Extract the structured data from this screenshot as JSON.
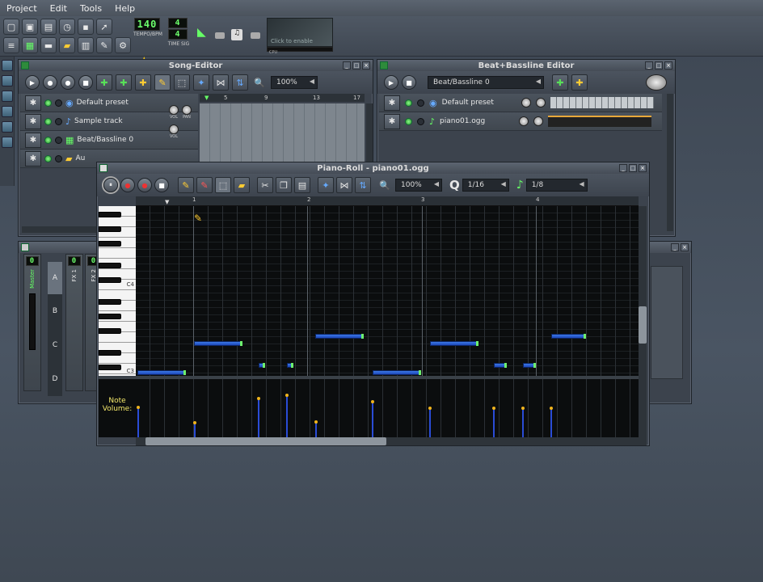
{
  "menu": [
    "Project",
    "Edit",
    "Tools",
    "Help"
  ],
  "toolbar": {
    "tempo": "140",
    "tempo_label": "TEMPO/BPM",
    "timesig_top": "4",
    "timesig_bottom": "4",
    "timesig_label": "TIME SIG",
    "cpu_hint": "Click to enable",
    "cpu_label": "CPU"
  },
  "song_editor": {
    "title": "Song-Editor",
    "zoom": "100%",
    "tracks": [
      "Default preset",
      "Sample track",
      "Beat/Bassline 0",
      "Au"
    ],
    "ruler": [
      "1",
      "5",
      "9",
      "13",
      "17"
    ]
  },
  "bb_editor": {
    "title": "Beat+Bassline Editor",
    "selected": "Beat/Bassline 0",
    "tracks": [
      "Default preset",
      "piano01.ogg"
    ]
  },
  "piano_roll": {
    "title": "Piano-Roll - piano01.ogg",
    "zoom": "100%",
    "q_label": "Q",
    "quant": "1/16",
    "note_len": "1/8",
    "ruler": [
      "1",
      "2",
      "3",
      "4"
    ],
    "key_c4": "C4",
    "key_c3": "C3",
    "volume_label": "Note\nVolume:"
  },
  "mixer": {
    "channels": [
      "Master",
      "FX 1",
      "FX 2"
    ],
    "tabs": [
      "A",
      "B",
      "C",
      "D"
    ],
    "lcd": "0"
  },
  "knob_labels": {
    "vol": "VOL",
    "pan": "PAN"
  },
  "colors": {
    "note": "#2250cc",
    "note_end": "#6ef06e",
    "volume_dot": "#f0b41c",
    "lcd": "#6cff6c"
  }
}
